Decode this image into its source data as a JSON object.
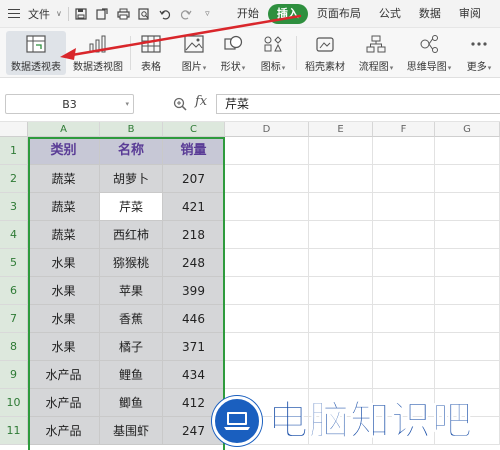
{
  "menu": {
    "file_label": "文件",
    "tabs": [
      {
        "label": "开始",
        "active": false
      },
      {
        "label": "插入",
        "active": true
      },
      {
        "label": "页面布局",
        "active": false
      },
      {
        "label": "公式",
        "active": false
      },
      {
        "label": "数据",
        "active": false
      },
      {
        "label": "审阅",
        "active": false
      }
    ]
  },
  "ribbon": {
    "items": [
      {
        "label": "数据透视表",
        "icon": "pivot-table-icon"
      },
      {
        "label": "数据透视图",
        "icon": "pivot-chart-icon"
      },
      {
        "label": "表格",
        "icon": "table-icon"
      },
      {
        "label": "图片",
        "icon": "picture-icon"
      },
      {
        "label": "形状",
        "icon": "shape-icon"
      },
      {
        "label": "图标",
        "icon": "icons-icon"
      },
      {
        "label": "稻壳素材",
        "icon": "material-icon"
      },
      {
        "label": "流程图",
        "icon": "flowchart-icon"
      },
      {
        "label": "思维导图",
        "icon": "mindmap-icon"
      },
      {
        "label": "更多",
        "icon": "more-icon"
      }
    ]
  },
  "formula_bar": {
    "cell_ref": "B3",
    "fx": "fx",
    "content": "芹菜"
  },
  "sheet": {
    "columns": [
      "A",
      "B",
      "C",
      "D",
      "E",
      "F",
      "G"
    ],
    "rows": [
      "1",
      "2",
      "3",
      "4",
      "5",
      "6",
      "7",
      "8",
      "9",
      "10",
      "11"
    ],
    "header": [
      "类别",
      "名称",
      "销量"
    ],
    "data": [
      [
        "蔬菜",
        "胡萝卜",
        "207"
      ],
      [
        "蔬菜",
        "芹菜",
        "421"
      ],
      [
        "蔬菜",
        "西红柿",
        "218"
      ],
      [
        "水果",
        "猕猴桃",
        "248"
      ],
      [
        "水果",
        "苹果",
        "399"
      ],
      [
        "水果",
        "香蕉",
        "446"
      ],
      [
        "水果",
        "橘子",
        "371"
      ],
      [
        "水产品",
        "鲤鱼",
        "434"
      ],
      [
        "水产品",
        "鲫鱼",
        "412"
      ],
      [
        "水产品",
        "基围虾",
        "247"
      ]
    ]
  },
  "watermark": {
    "text": "电脑知识吧"
  },
  "colors": {
    "accent": "#2e8f3e",
    "header_text": "#5a3c96",
    "arrow": "#d9262b",
    "watermark": "#1a4fa8"
  }
}
